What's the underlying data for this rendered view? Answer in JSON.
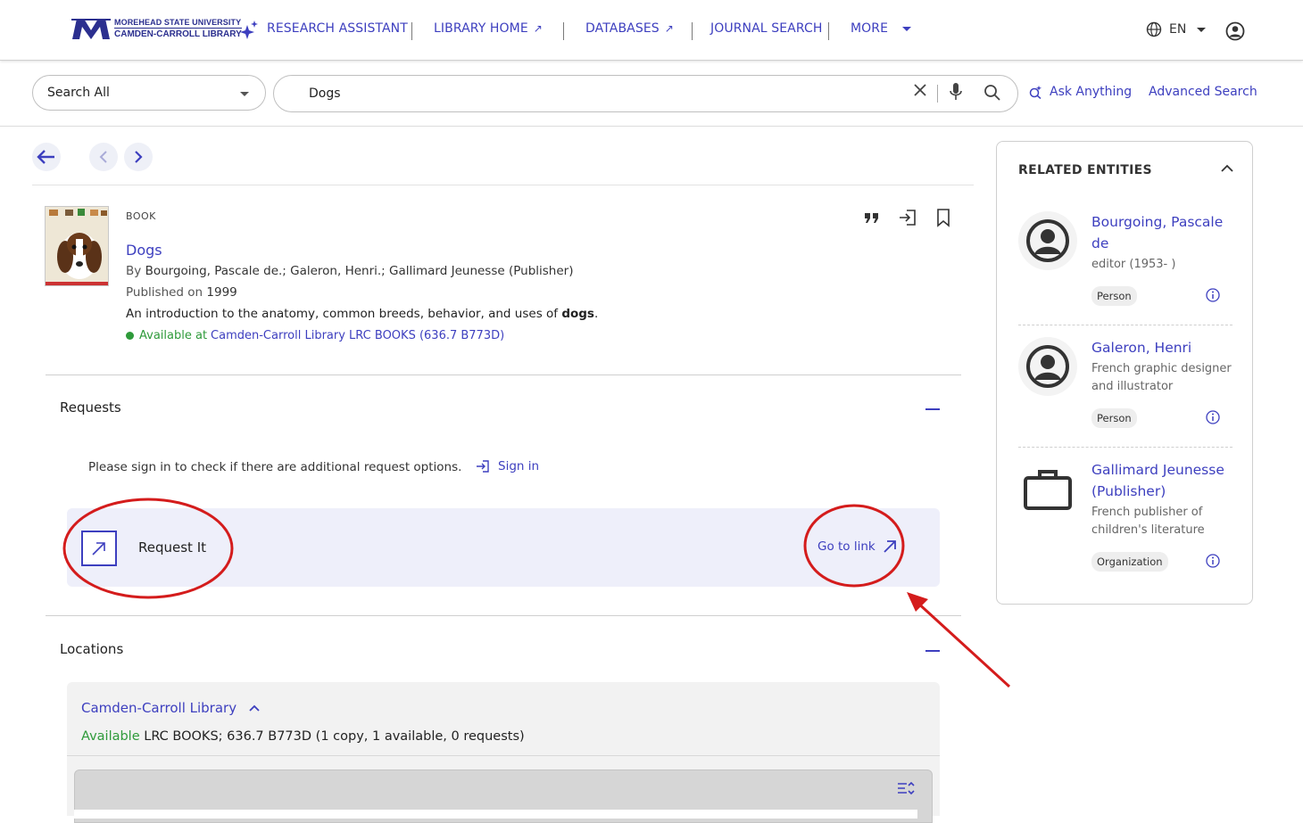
{
  "header": {
    "logo": {
      "line1": "MOREHEAD STATE UNIVERSITY",
      "line2": "CAMDEN-CARROLL LIBRARY"
    },
    "nav": [
      {
        "label": "RESEARCH ASSISTANT"
      },
      {
        "label": "LIBRARY HOME",
        "external": "↗"
      },
      {
        "label": "DATABASES",
        "external": "↗"
      },
      {
        "label": "JOURNAL SEARCH"
      },
      {
        "label": "MORE"
      }
    ],
    "language": "EN"
  },
  "search": {
    "scope": "Search All",
    "query": "Dogs",
    "ask_anything": "Ask Anything",
    "advanced": "Advanced Search"
  },
  "record": {
    "type": "BOOK",
    "title": "Dogs",
    "by_prefix": "By",
    "authors": "Bourgoing, Pascale de.; Galeron, Henri.; Gallimard Jeunesse (Publisher)",
    "published_prefix": "Published on",
    "published": "1999",
    "description_start": "An introduction to the anatomy, common breeds, behavior, and uses of ",
    "description_highlight": "dogs",
    "description_end": ".",
    "availability_prefix": "Available at",
    "availability_location": "Camden-Carroll Library LRC BOOKS (636.7 B773D)"
  },
  "requests": {
    "title": "Requests",
    "signin_message": "Please sign in to check if there are additional request options.",
    "signin_label": "Sign in",
    "request_label": "Request It",
    "go_to_link": "Go to link"
  },
  "locations": {
    "title": "Locations",
    "library": "Camden-Carroll Library",
    "status": "Available",
    "details": "LRC BOOKS;  636.7 B773D  (1 copy, 1 available, 0 requests)"
  },
  "related": {
    "title": "RELATED ENTITIES",
    "entities": [
      {
        "name": "Bourgoing, Pascale de",
        "desc": "editor (1953- )",
        "badge": "Person",
        "icon": "person-icon"
      },
      {
        "name": "Galeron, Henri",
        "desc": "French graphic designer and illustrator",
        "badge": "Person",
        "icon": "person-icon"
      },
      {
        "name": "Gallimard Jeunesse (Publisher)",
        "desc": "French publisher of children's literature",
        "badge": "Organization",
        "icon": "briefcase-icon"
      }
    ]
  },
  "colors": {
    "accent": "#3d3fbf",
    "available": "#2e9a3a",
    "annotation": "#d41c1c"
  }
}
